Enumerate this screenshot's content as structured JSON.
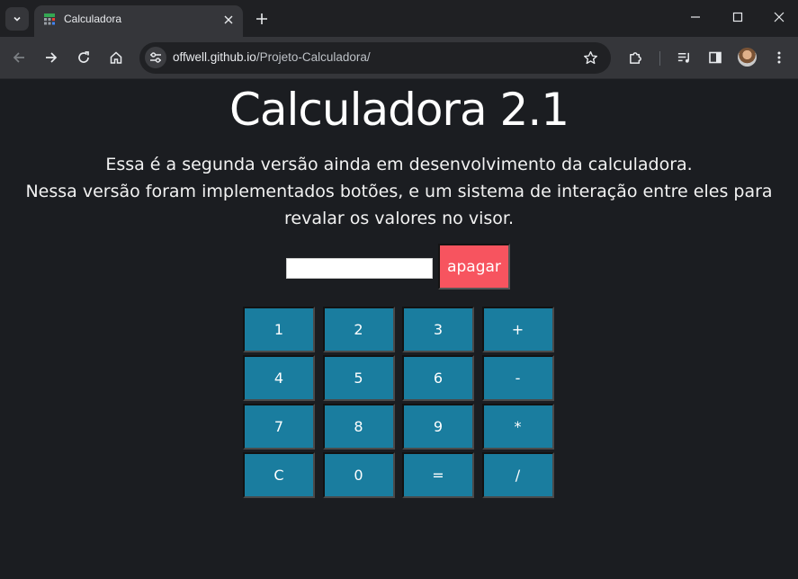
{
  "browser": {
    "tab_title": "Calculadora",
    "url_host": "offwell.github.io",
    "url_path": "/Projeto-Calculadora/"
  },
  "page": {
    "title": "Calculadora 2.1",
    "description_lines": [
      "Essa é a segunda versão ainda em desenvolvimento da calculadora.",
      "Nessa versão foram implementados botões, e um sistema de interação entre eles para revalar os valores no visor."
    ],
    "display_value": "",
    "clear_label": "apagar",
    "keys": [
      "1",
      "2",
      "3",
      "+",
      "4",
      "5",
      "6",
      "-",
      "7",
      "8",
      "9",
      "*",
      "C",
      "0",
      "=",
      "/"
    ]
  },
  "colors": {
    "page_bg": "#1b1d21",
    "key_bg": "#1a7d9f",
    "clear_bg": "#f7545f"
  },
  "icons": {
    "tab_favicon": "calculator-icon",
    "tab_search": "chevron-down-icon",
    "back": "arrow-left-icon",
    "forward": "arrow-right-icon",
    "reload": "reload-icon",
    "home": "home-icon",
    "site_info": "tune-icon",
    "bookmark": "star-icon",
    "extensions": "puzzle-icon",
    "media": "playlist-icon",
    "side_panel": "side-panel-icon",
    "menu": "kebab-menu-icon"
  }
}
